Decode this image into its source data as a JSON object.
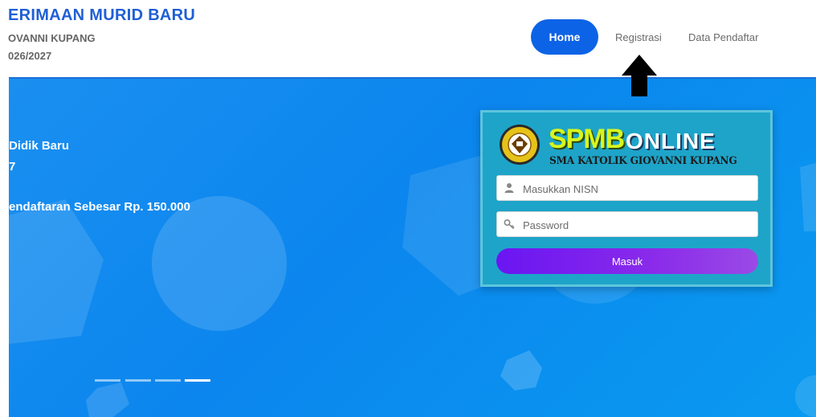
{
  "header": {
    "title": "ERIMAAN MURID BARU",
    "school": "OVANNI KUPANG",
    "year": "026/2027"
  },
  "nav": {
    "home": "Home",
    "registrasi": "Registrasi",
    "data_pendaftar": "Data Pendaftar"
  },
  "hero": {
    "line1": "Didik Baru",
    "line2": "7",
    "line3": "endaftaran Sebesar Rp. 150.000",
    "carousel": {
      "count": 4,
      "active_index": 4
    }
  },
  "login": {
    "logo_spmb": "SPMB",
    "logo_online": "ONLINE",
    "logo_school": "SMA KATOLIK GIOVANNI KUPANG",
    "nisn_placeholder": "Masukkan NISN",
    "password_placeholder": "Password",
    "submit_label": "Masuk"
  },
  "icons": {
    "user": "user-icon",
    "key": "key-icon",
    "arrow": "arrow-up-icon"
  },
  "colors": {
    "primary": "#0d63e6",
    "hero_blue": "#0b86ee",
    "card_teal": "#1ea4c9",
    "button_purple": "#7a1ff0",
    "brand_text": "#1f5fd6"
  }
}
